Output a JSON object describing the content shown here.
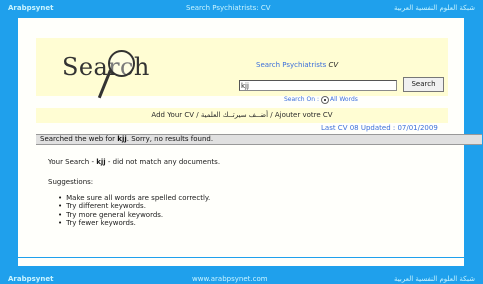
{
  "header": {
    "left": "Arabpsynet",
    "center": "Search Psychiatrists: CV",
    "right": "شبكة العلوم النفسية العربية"
  },
  "logo": {
    "text": "Search"
  },
  "search_panel": {
    "title_main": "Search Psychiatrists",
    "title_italic": "CV",
    "query_value": "kjj",
    "button_label": "Search",
    "search_on_label": "Search On :",
    "option_label": "All Words"
  },
  "add_cv": {
    "text": "Add Your CV / أضــف سيرتــك العلمية / Ajouter votre CV"
  },
  "last_update": {
    "text": "Last CV 08 Updated : 07/01/2009"
  },
  "result_bar": {
    "prefix": "Searched the web for ",
    "query": "kjj",
    "suffix": ". Sorry, no results found."
  },
  "no_match": {
    "prefix": "Your Search - ",
    "query": "kjj",
    "suffix": " - did not match any documents."
  },
  "suggestions": {
    "heading": "Suggestions:",
    "items": [
      "Make sure all words are spelled correctly.",
      "Try different keywords.",
      "Try more general keywords.",
      "Try fewer keywords."
    ]
  },
  "footer": {
    "left": "Arabpsynet",
    "center": "www.arabpsynet.com",
    "right": "شبكة العلوم النفسية العربية"
  },
  "colors": {
    "background": "#1fa0ec",
    "panel": "#fffdd3",
    "link_blue": "#3b6edb"
  },
  "icons": {
    "logo": "magnifying-glass-icon",
    "radio": "radio-selected-icon"
  }
}
